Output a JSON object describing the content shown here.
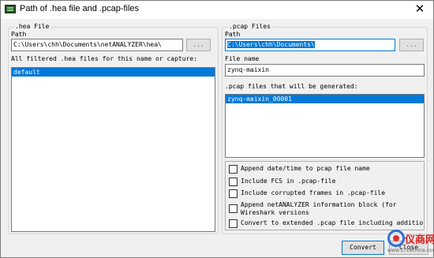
{
  "window": {
    "title": "Path of .hea file and .pcap-files",
    "close_glyph": "✕"
  },
  "hea_group": {
    "legend": ".hea File",
    "path_label": "Path",
    "path_value": "C:\\Users\\chh\\Documents\\netANALYZER\\hea\\",
    "browse_label": "...",
    "list_label": "All filtered .hea files for this name or capture:",
    "files": [
      "default"
    ]
  },
  "pcap_group": {
    "legend": ".pcap Files",
    "path_label": "Path",
    "path_value": "C:\\Users\\chh\\Documents\\",
    "browse_label": "...",
    "filename_label": "File name",
    "filename_value": "zynq-maixin",
    "generated_label": ".pcap files that will be generated:",
    "generated_files": [
      "zynq-maixin_00001"
    ]
  },
  "options": [
    {
      "label": "Append date/time to pcap file name",
      "checked": false
    },
    {
      "label": "Include FCS in .pcap-file",
      "checked": false
    },
    {
      "label": "Include corrupted frames in .pcap-file",
      "checked": false
    },
    {
      "label": "Append netANALYZER information block (for Wireshark versions",
      "checked": false
    },
    {
      "label": "Convert to extended .pcap file including additional fr",
      "checked": false
    }
  ],
  "buttons": {
    "convert": "Convert",
    "close": "Close"
  },
  "watermark": {
    "text": "仪商网",
    "sub": "www.1718china.com"
  },
  "colors": {
    "selection": "#0078d7",
    "group_border": "#d5d5d5"
  }
}
